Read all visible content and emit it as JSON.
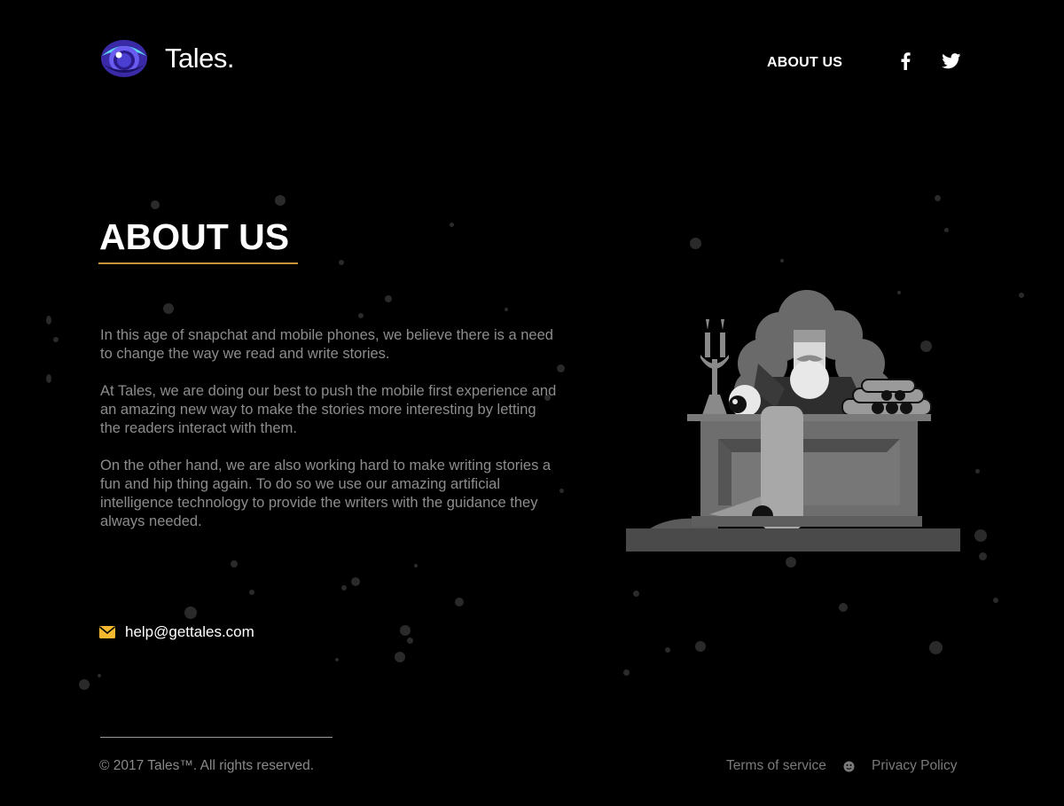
{
  "brand": {
    "name": "Tales.",
    "logo_icon": "eye-icon"
  },
  "nav": {
    "about_label": "ABOUT US",
    "facebook_icon": "facebook-icon",
    "twitter_icon": "twitter-icon"
  },
  "main": {
    "heading": "ABOUT US",
    "paragraphs": [
      "In this age of snapchat and mobile phones, we believe there is a need to change the way we read and write stories.",
      "At Tales, we are doing our best to push the mobile first experience and an amazing new way to make the stories more interesting by letting the readers interact with them.",
      "On the other hand, we are also working hard to make writing stories a fun and hip thing again. To do so we use our amazing artificial intelligence technology to provide the writers with the guidance they always needed."
    ],
    "illustration": "writer-at-desk-illustration"
  },
  "contact": {
    "email": "help@gettales.com",
    "icon": "mail-icon"
  },
  "footer": {
    "copyright": "© 2017 Tales™. All rights reserved.",
    "terms_label": "Terms of service",
    "separator_icon": "smiley-icon",
    "privacy_label": "Privacy Policy"
  },
  "colors": {
    "background": "#000000",
    "accent": "#c8923a",
    "mail_icon": "#f5b82e",
    "body_text": "#8c8c8c",
    "logo_blue": "#4a3fd0",
    "logo_teal": "#5ad6e8"
  }
}
